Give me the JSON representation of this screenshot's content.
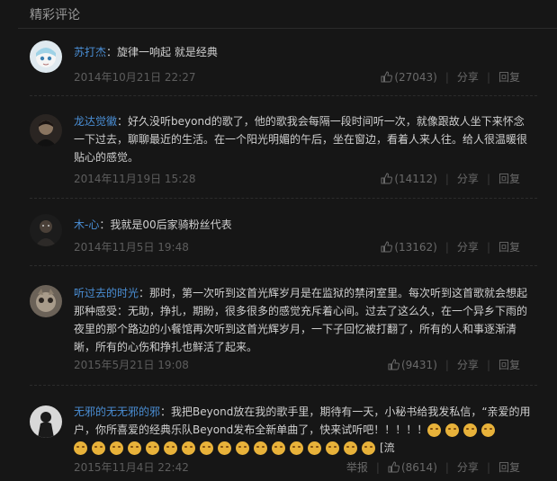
{
  "header": {
    "title": "精彩评论"
  },
  "comments": [
    {
      "user": "苏打杰",
      "text": "旋律一响起 就是经典",
      "time": "2014年10月21日 22:27",
      "likes": "(27043)",
      "share": "分享",
      "reply": "回复"
    },
    {
      "user": "龙达觉徽",
      "text": "好久没听beyond的歌了，他的歌我会每隔一段时间听一次，就像跟故人坐下来怀念一下过去，聊聊最近的生活。在一个阳光明媚的午后，坐在窗边，看着人来人往。给人很温暖很贴心的感觉。",
      "time": "2014年11月19日 15:28",
      "likes": "(14112)",
      "share": "分享",
      "reply": "回复"
    },
    {
      "user": "木-心",
      "text": "我就是00后家骑粉丝代表",
      "time": "2014年11月5日 19:48",
      "likes": "(13162)",
      "share": "分享",
      "reply": "回复"
    },
    {
      "user": "听过去的时光",
      "text": "那时，第一次听到这首光辉岁月是在监狱的禁闭室里。每次听到这首歌就会想起那种感受：无助，挣扎，期盼，很多很多的感觉充斥着心间。过去了这么久，在一个异乡下雨的夜里的那个路边的小餐馆再次听到这首光辉岁月，一下子回忆被打翻了，所有的人和事逐渐清晰，所有的心伤和挣扎也鲜活了起来。",
      "time": "2015年5月21日 19:08",
      "likes": "(9431)",
      "share": "分享",
      "reply": "回复"
    },
    {
      "user": "无邪的无无邪的邪",
      "text": "我把Beyond放在我的歌手里，期待有一天，小秘书给我发私信，“亲爱的用户，你所喜爱的经典乐队Beyond发布全新单曲了，快来试听吧！！！！！",
      "tail": "[流",
      "time": "2015年11月4日 22:42",
      "report": "举报",
      "likes": "(8614)",
      "share": "分享",
      "reply": "回复"
    }
  ],
  "icons": {
    "like": "thumbs-up-icon"
  },
  "colors": {
    "username": "#4a8fd6",
    "background": "#161616"
  }
}
